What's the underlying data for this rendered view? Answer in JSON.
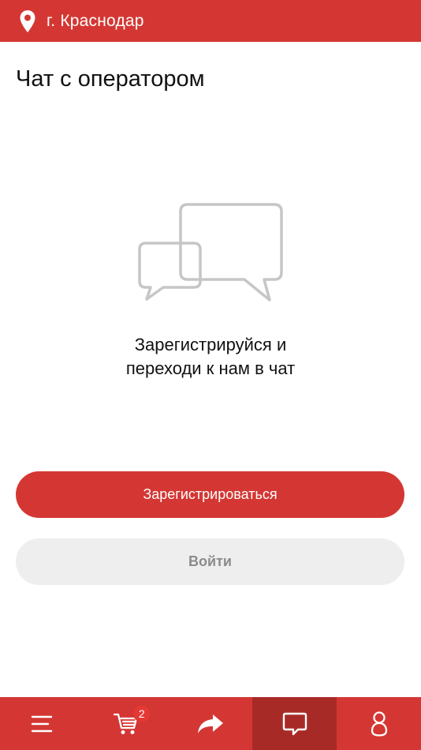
{
  "header": {
    "city": "г. Краснодар",
    "pin_icon": "location-pin-icon"
  },
  "page": {
    "title": "Чат с оператором"
  },
  "empty_state": {
    "icon": "chat-bubbles-icon",
    "message_line1": "Зарегистрируйся и",
    "message_line2": "переходи к нам в чат"
  },
  "buttons": {
    "register_label": "Зарегистрироваться",
    "login_label": "Войти"
  },
  "bottom_nav": {
    "items": [
      {
        "icon": "menu-icon"
      },
      {
        "icon": "cart-icon",
        "badge": "2"
      },
      {
        "icon": "share-icon"
      },
      {
        "icon": "chat-icon",
        "active": true
      },
      {
        "icon": "user-icon"
      }
    ]
  },
  "colors": {
    "brand": "#d43733",
    "brand_active": "#a82a27",
    "secondary_bg": "#efeeee"
  }
}
